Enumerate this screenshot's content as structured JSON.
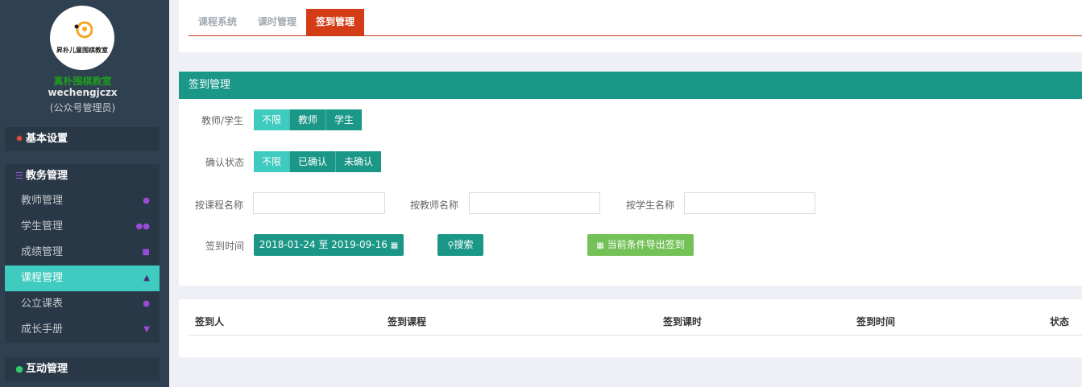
{
  "sidebar": {
    "logo_text": "昇朴儿童围棋教室",
    "school_name": "真朴围棋教室",
    "user_name": "wechengjczx",
    "user_role": "(公众号管理员)",
    "groups": [
      {
        "title": "基本设置",
        "icon": "gear-icon",
        "icon_color": "#e74c3c"
      },
      {
        "title": "教务管理",
        "icon": "database-icon",
        "icon_color": "#8e44ad",
        "items": [
          {
            "label": "教师管理",
            "icon": "user-icon"
          },
          {
            "label": "学生管理",
            "icon": "users-icon"
          },
          {
            "label": "成绩管理",
            "icon": "book-icon"
          },
          {
            "label": "课程管理",
            "icon": "graduation-cap-icon",
            "active": true
          },
          {
            "label": "公立课表",
            "icon": "github-icon"
          },
          {
            "label": "成长手册",
            "icon": "trophy-icon"
          }
        ]
      },
      {
        "title": "互动管理",
        "icon": "wechat-icon",
        "icon_color": "#2ecc71"
      }
    ]
  },
  "tabs": [
    {
      "label": "课程系统",
      "active": false
    },
    {
      "label": "课时管理",
      "active": false
    },
    {
      "label": "签到管理",
      "active": true
    }
  ],
  "filter_box": {
    "title": "签到管理",
    "teacher_student": {
      "label": "教师/学生",
      "options": [
        "不限",
        "教师",
        "学生"
      ],
      "selected": "不限"
    },
    "confirm_status": {
      "label": "确认状态",
      "options": [
        "不限",
        "已确认",
        "未确认"
      ],
      "selected": "不限"
    },
    "search_fields": [
      {
        "label": "按课程名称",
        "value": "",
        "placeholder": ""
      },
      {
        "label": "按教师名称",
        "value": "",
        "placeholder": ""
      },
      {
        "label": "按学生名称",
        "value": "",
        "placeholder": ""
      }
    ],
    "signin_time": {
      "label": "签到时间",
      "range": "2018-01-24 至 2019-09-16"
    },
    "search_button": "搜索",
    "export_button": "当前条件导出签到"
  },
  "table": {
    "columns": [
      "签到人",
      "签到课程",
      "签到课时",
      "签到时间",
      "状态"
    ],
    "rows": []
  },
  "colors": {
    "sidebar_bg": "#2f4050",
    "accent_teal": "#1a9787",
    "active_teal": "#3fcbbf",
    "tab_active": "#d43c17",
    "export_green": "#74c157"
  }
}
